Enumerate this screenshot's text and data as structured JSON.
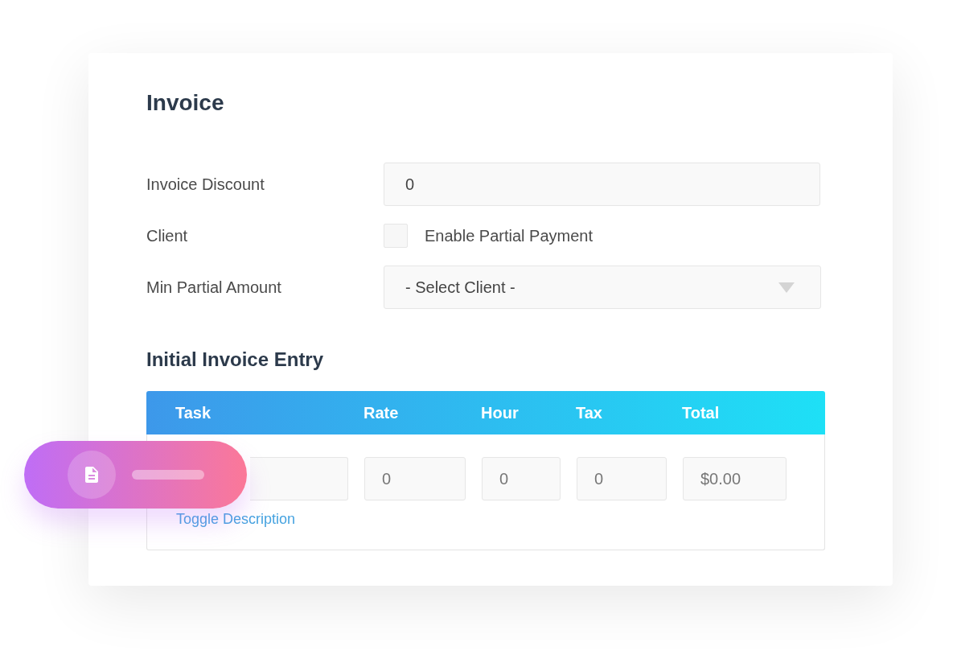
{
  "form": {
    "title": "Invoice",
    "fields": [
      {
        "kind": "text",
        "label": "Invoice Discount",
        "value": "0"
      },
      {
        "kind": "checkbox",
        "label": "Client",
        "option": "Enable Partial Payment",
        "checked": false
      },
      {
        "kind": "select",
        "label": "Min Partial Amount",
        "value": "- Select Client -"
      }
    ]
  },
  "entry": {
    "title": "Initial Invoice Entry",
    "columns": [
      "Task",
      "Rate",
      "Hour",
      "Tax",
      "Total"
    ],
    "row_values": [
      "0",
      "0",
      "0",
      "$0.00"
    ],
    "link": "Toggle Description"
  }
}
